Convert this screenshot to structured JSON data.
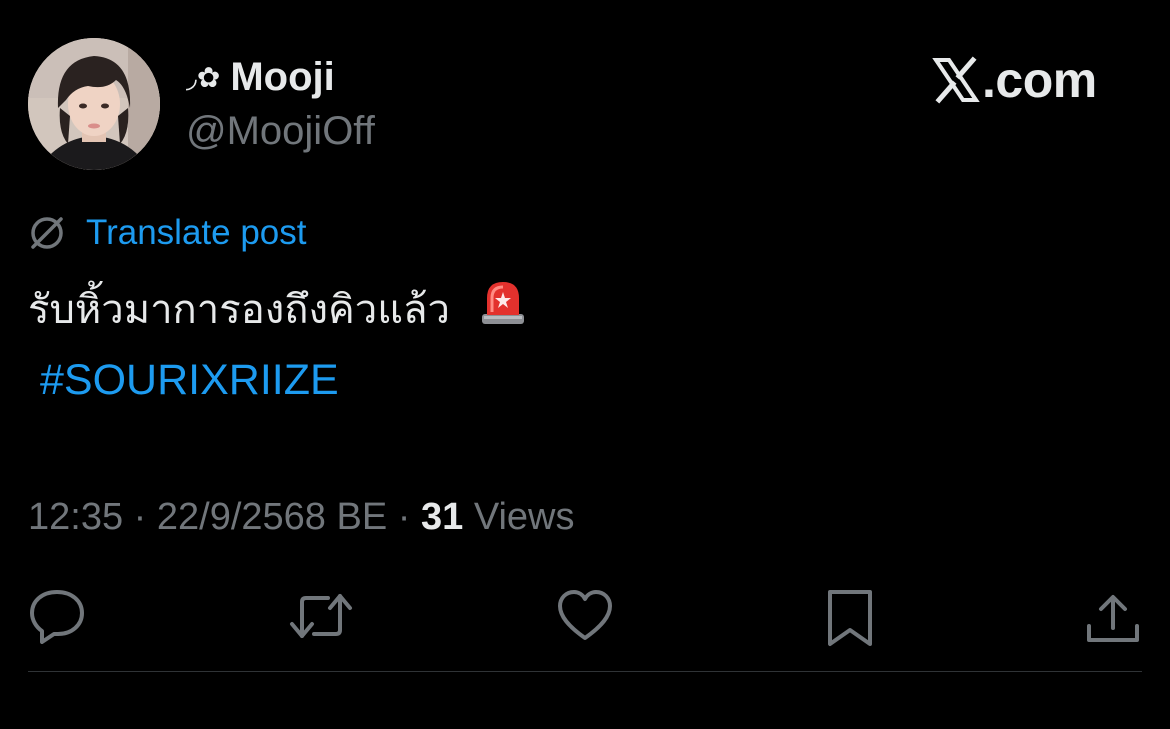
{
  "author": {
    "display_name_deco": "◞✿",
    "display_name": "Mooji",
    "handle": "@MoojiOff"
  },
  "brand": {
    "logo_icon": "x-logo-icon",
    "suffix": ".com"
  },
  "translate": {
    "icon": "globe-icon",
    "label": "Translate post"
  },
  "post": {
    "text": "รับหิ้วมาการองถึงคิวแล้ว",
    "emoji_icon": "rotating-light-icon",
    "hashtag": "#SOURIXRIIZE"
  },
  "meta": {
    "time": "12:35",
    "separator": "·",
    "date": "22/9/2568 BE",
    "views_count": "31",
    "views_label": "Views"
  },
  "actions": [
    {
      "name": "reply",
      "icon": "reply-icon"
    },
    {
      "name": "repost",
      "icon": "repost-icon"
    },
    {
      "name": "like",
      "icon": "heart-icon"
    },
    {
      "name": "bookmark",
      "icon": "bookmark-icon"
    },
    {
      "name": "share",
      "icon": "share-icon"
    }
  ],
  "colors": {
    "background": "#000000",
    "text_primary": "#e7e9ea",
    "text_secondary": "#71767b",
    "accent": "#1d9bf0",
    "divider": "#2f3336"
  }
}
